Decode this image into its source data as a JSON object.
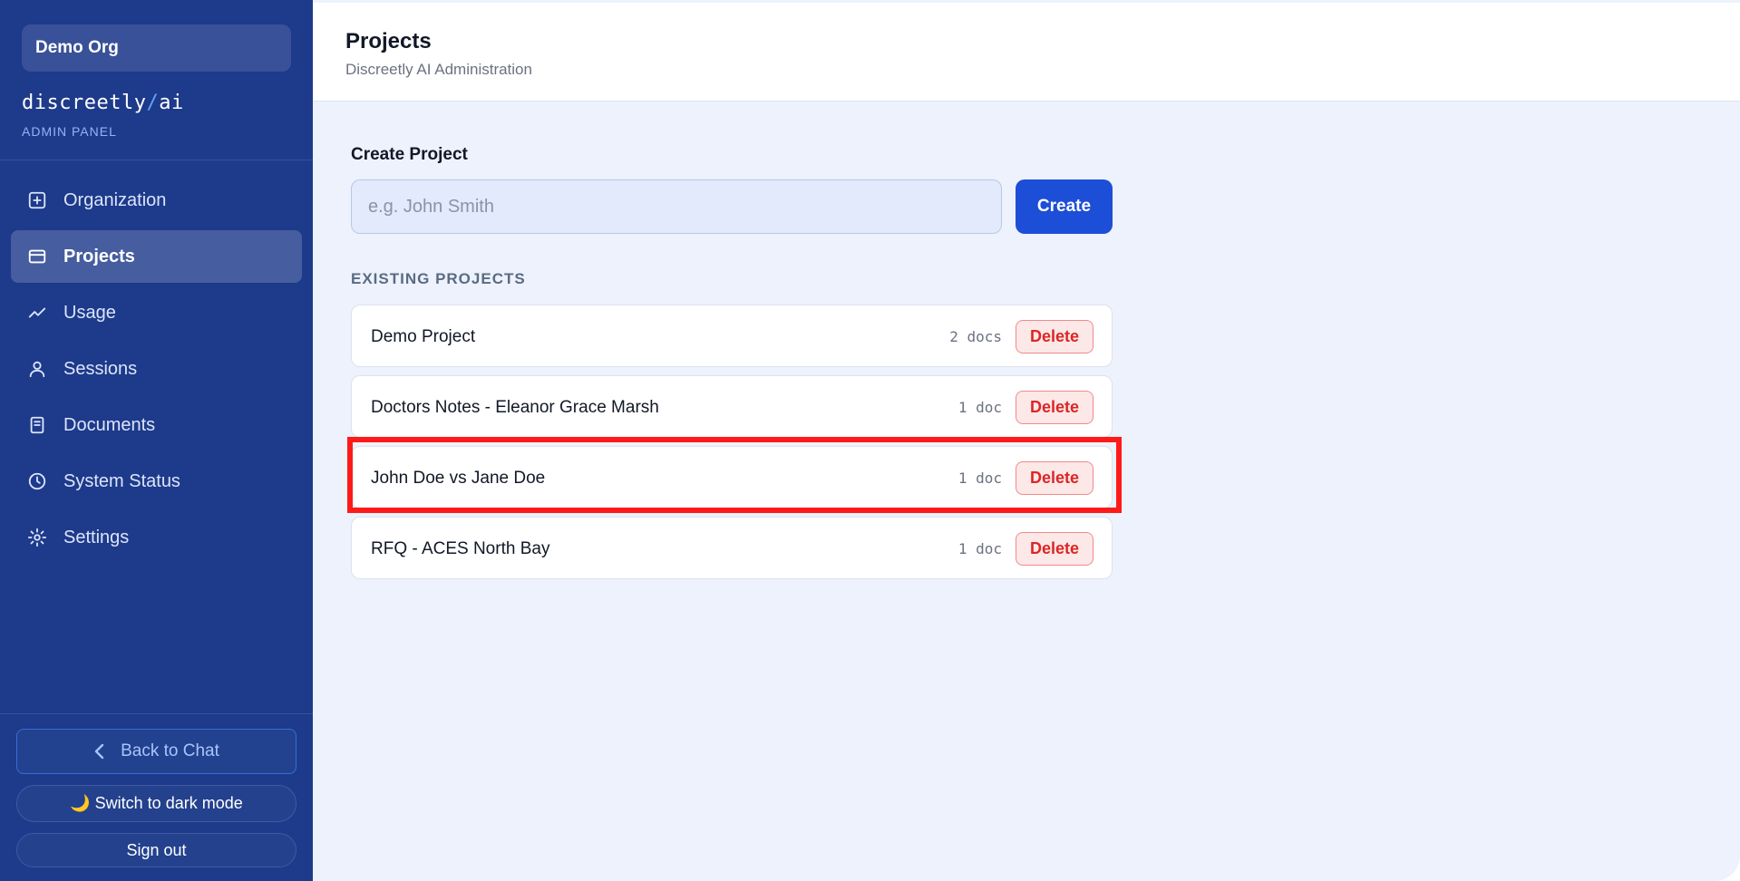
{
  "sidebar": {
    "org_name": "Demo Org",
    "brand_left": "discreetly",
    "brand_sep": "/",
    "brand_right": "ai",
    "brand_sub": "ADMIN PANEL",
    "items": [
      {
        "label": "Organization",
        "icon": "plus-square-icon",
        "active": false
      },
      {
        "label": "Projects",
        "icon": "folder-card-icon",
        "active": true
      },
      {
        "label": "Usage",
        "icon": "trend-line-icon",
        "active": false
      },
      {
        "label": "Sessions",
        "icon": "user-icon",
        "active": false
      },
      {
        "label": "Documents",
        "icon": "document-icon",
        "active": false
      },
      {
        "label": "System Status",
        "icon": "clock-icon",
        "active": false
      },
      {
        "label": "Settings",
        "icon": "gear-icon",
        "active": false
      }
    ],
    "back_label": "Back to Chat",
    "dark_mode_label": "🌙 Switch to dark mode",
    "sign_out_label": "Sign out"
  },
  "header": {
    "title": "Projects",
    "subtitle": "Discreetly AI Administration"
  },
  "create": {
    "label": "Create Project",
    "placeholder": "e.g. John Smith",
    "value": "",
    "button_label": "Create"
  },
  "existing": {
    "title": "EXISTING PROJECTS",
    "projects": [
      {
        "name": "Demo Project",
        "count": "2 docs",
        "delete_label": "Delete"
      },
      {
        "name": "Doctors Notes - Eleanor Grace Marsh",
        "count": "1 doc",
        "delete_label": "Delete"
      },
      {
        "name": "John Doe vs Jane Doe",
        "count": "1 doc",
        "delete_label": "Delete"
      },
      {
        "name": "RFQ - ACES North Bay",
        "count": "1 doc",
        "delete_label": "Delete"
      }
    ]
  },
  "colors": {
    "sidebar_bg": "#1e3a8a",
    "accent": "#1d4ed8",
    "danger": "#dc2626",
    "highlight": "#ff1a1a"
  }
}
